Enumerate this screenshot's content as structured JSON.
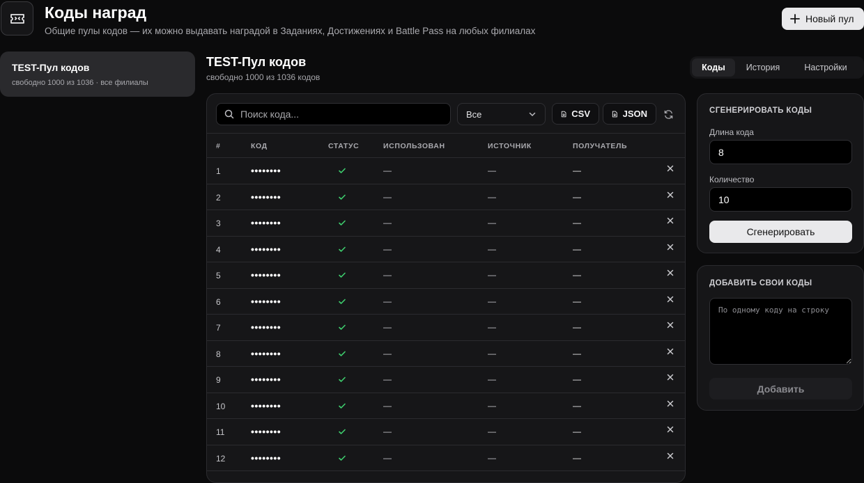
{
  "header": {
    "title": "Коды наград",
    "subtitle": "Общие пулы кодов — их можно выдавать наградой в Заданиях, Достижениях и Battle Pass на любых филиалах",
    "new_pool_label": "Новый пул"
  },
  "sidebar": {
    "pools": [
      {
        "name": "TEST-Пул кодов",
        "meta": "свободно 1000 из 1036 · все филиалы"
      }
    ]
  },
  "pool": {
    "title": "TEST-Пул кодов",
    "subtitle": "свободно 1000 из 1036 кодов"
  },
  "tabs": [
    {
      "label": "Коды",
      "active": true
    },
    {
      "label": "История",
      "active": false
    },
    {
      "label": "Настройки",
      "active": false
    }
  ],
  "toolbar": {
    "search_placeholder": "Поиск кода...",
    "filter_value": "Все",
    "csv_label": "CSV",
    "json_label": "JSON"
  },
  "table": {
    "columns": [
      "#",
      "КОД",
      "СТАТУС",
      "ИСПОЛЬЗОВАН",
      "ИСТОЧНИК",
      "ПОЛУЧАТЕЛЬ"
    ],
    "rows": [
      {
        "num": "1",
        "code": "••••••••",
        "used": "—",
        "source": "—",
        "recipient": "—"
      },
      {
        "num": "2",
        "code": "••••••••",
        "used": "—",
        "source": "—",
        "recipient": "—"
      },
      {
        "num": "3",
        "code": "••••••••",
        "used": "—",
        "source": "—",
        "recipient": "—"
      },
      {
        "num": "4",
        "code": "••••••••",
        "used": "—",
        "source": "—",
        "recipient": "—"
      },
      {
        "num": "5",
        "code": "••••••••",
        "used": "—",
        "source": "—",
        "recipient": "—"
      },
      {
        "num": "6",
        "code": "••••••••",
        "used": "—",
        "source": "—",
        "recipient": "—"
      },
      {
        "num": "7",
        "code": "••••••••",
        "used": "—",
        "source": "—",
        "recipient": "—"
      },
      {
        "num": "8",
        "code": "••••••••",
        "used": "—",
        "source": "—",
        "recipient": "—"
      },
      {
        "num": "9",
        "code": "••••••••",
        "used": "—",
        "source": "—",
        "recipient": "—"
      },
      {
        "num": "10",
        "code": "••••••••",
        "used": "—",
        "source": "—",
        "recipient": "—"
      },
      {
        "num": "11",
        "code": "••••••••",
        "used": "—",
        "source": "—",
        "recipient": "—"
      },
      {
        "num": "12",
        "code": "••••••••",
        "used": "—",
        "source": "—",
        "recipient": "—"
      }
    ]
  },
  "generate": {
    "title": "СГЕНЕРИРОВАТЬ КОДЫ",
    "length_label": "Длина кода",
    "length_value": "8",
    "count_label": "Количество",
    "count_value": "10",
    "button_label": "Сгенерировать"
  },
  "add_codes": {
    "title": "ДОБАВИТЬ СВОИ КОДЫ",
    "placeholder": "По одному коду на строку",
    "button_label": "Добавить"
  },
  "colors": {
    "status_ok": "#3ecf6e",
    "accent_button": "#e9e9eb"
  }
}
